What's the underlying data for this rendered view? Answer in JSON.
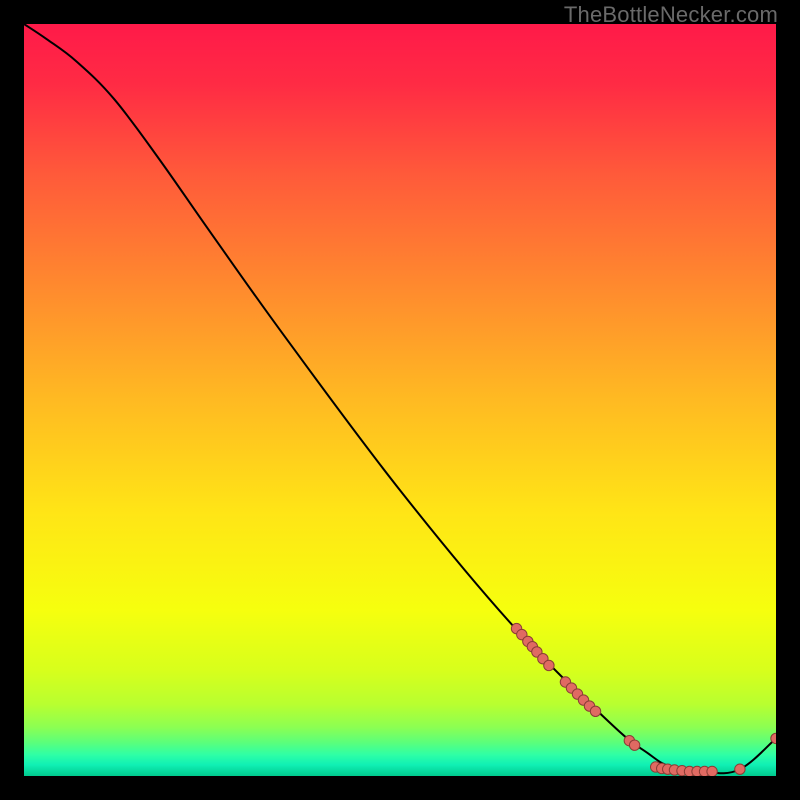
{
  "watermark": "TheBottleNecker.com",
  "chart_data": {
    "type": "line",
    "title": "",
    "xlabel": "",
    "ylabel": "",
    "xlim": [
      0,
      100
    ],
    "ylim": [
      0,
      100
    ],
    "grid": false,
    "legend": false,
    "background": "rainbow-vertical",
    "curve": [
      {
        "x": 0,
        "y": 100
      },
      {
        "x": 3,
        "y": 98
      },
      {
        "x": 7,
        "y": 95
      },
      {
        "x": 12,
        "y": 90
      },
      {
        "x": 18,
        "y": 82
      },
      {
        "x": 25,
        "y": 72
      },
      {
        "x": 35,
        "y": 58
      },
      {
        "x": 50,
        "y": 38
      },
      {
        "x": 65,
        "y": 20
      },
      {
        "x": 78,
        "y": 7
      },
      {
        "x": 83,
        "y": 3
      },
      {
        "x": 86,
        "y": 1.2
      },
      {
        "x": 90,
        "y": 0.6
      },
      {
        "x": 95,
        "y": 0.8
      },
      {
        "x": 100,
        "y": 5
      }
    ],
    "marker_clusters": [
      {
        "x": 65.5,
        "y": 19.6
      },
      {
        "x": 66.2,
        "y": 18.8
      },
      {
        "x": 67.0,
        "y": 17.9
      },
      {
        "x": 67.6,
        "y": 17.2
      },
      {
        "x": 68.2,
        "y": 16.5
      },
      {
        "x": 69.0,
        "y": 15.6
      },
      {
        "x": 69.8,
        "y": 14.7
      },
      {
        "x": 72.0,
        "y": 12.5
      },
      {
        "x": 72.8,
        "y": 11.7
      },
      {
        "x": 73.6,
        "y": 10.9
      },
      {
        "x": 74.4,
        "y": 10.1
      },
      {
        "x": 75.2,
        "y": 9.3
      },
      {
        "x": 76.0,
        "y": 8.6
      },
      {
        "x": 80.5,
        "y": 4.7
      },
      {
        "x": 81.2,
        "y": 4.1
      },
      {
        "x": 84.0,
        "y": 1.2
      },
      {
        "x": 84.8,
        "y": 1.0
      },
      {
        "x": 85.6,
        "y": 0.9
      },
      {
        "x": 86.5,
        "y": 0.8
      },
      {
        "x": 87.5,
        "y": 0.7
      },
      {
        "x": 88.5,
        "y": 0.6
      },
      {
        "x": 89.5,
        "y": 0.6
      },
      {
        "x": 90.5,
        "y": 0.6
      },
      {
        "x": 91.5,
        "y": 0.6
      },
      {
        "x": 95.2,
        "y": 0.9
      },
      {
        "x": 100.0,
        "y": 5.0
      }
    ],
    "gradient_stops": [
      {
        "offset": 0.0,
        "color": "#ff1a49"
      },
      {
        "offset": 0.08,
        "color": "#ff2b44"
      },
      {
        "offset": 0.2,
        "color": "#ff5a3a"
      },
      {
        "offset": 0.35,
        "color": "#ff8a2e"
      },
      {
        "offset": 0.5,
        "color": "#ffba22"
      },
      {
        "offset": 0.65,
        "color": "#ffe516"
      },
      {
        "offset": 0.78,
        "color": "#f6ff0e"
      },
      {
        "offset": 0.86,
        "color": "#d7ff1c"
      },
      {
        "offset": 0.905,
        "color": "#b8ff30"
      },
      {
        "offset": 0.935,
        "color": "#8cff52"
      },
      {
        "offset": 0.955,
        "color": "#5cff7a"
      },
      {
        "offset": 0.972,
        "color": "#2effa6"
      },
      {
        "offset": 0.985,
        "color": "#10f0b4"
      },
      {
        "offset": 1.0,
        "color": "#00c98e"
      }
    ],
    "line_color": "#000000",
    "marker_color": "#e06a62",
    "marker_stroke": "#8a3d36"
  }
}
